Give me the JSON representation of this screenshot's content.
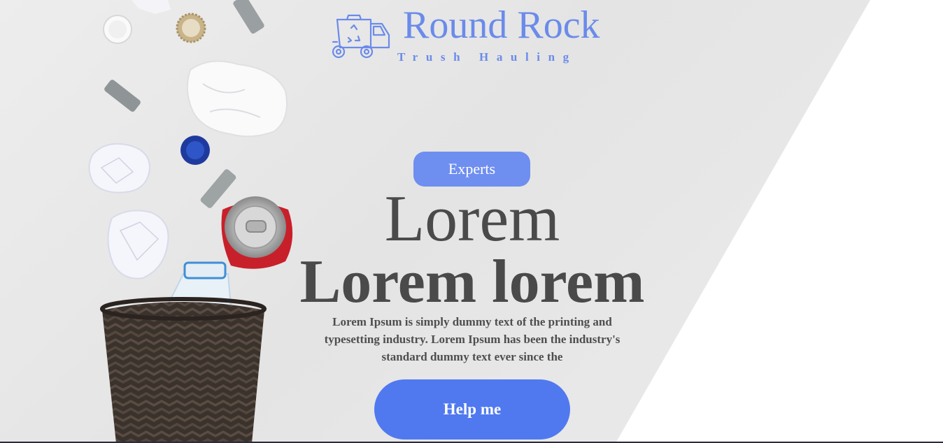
{
  "brand": {
    "name": "Round Rock",
    "tagline": "Trush Hauling",
    "color": "#6b8bea",
    "icon": "garbage-truck-icon"
  },
  "hero": {
    "badge": "Experts",
    "headline_line1": "Lorem",
    "headline_line2": "Lorem lorem",
    "description": "Lorem Ipsum is simply dummy text of the printing and typesetting industry. Lorem Ipsum has been the industry's standard dummy text ever since the",
    "cta_label": "Help me"
  },
  "colors": {
    "accent": "#5079f0",
    "badge": "#6e8ef0",
    "text": "#4a4a4a"
  }
}
